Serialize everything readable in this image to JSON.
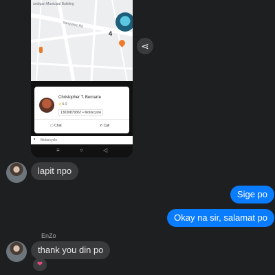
{
  "shared_screenshot": {
    "map": {
      "building_label": "andigan Municipal Building",
      "road_label": "Sampaloc Rd",
      "count": "4"
    },
    "driver": {
      "name": "Christopher T. Bernarte",
      "rating": "5.0",
      "plate_and_vehicle": "13030879367 • Motorcycle"
    },
    "actions": {
      "chat": "Chat",
      "call": "Call"
    },
    "mode": "Motorcycle",
    "nav": {
      "menu": "≡",
      "home": "○",
      "back": "◁"
    }
  },
  "icons": {
    "share": "share-icon",
    "star": "star-icon",
    "heart": "heart-icon"
  },
  "colors": {
    "outgoing_bubble": "#0a7cff",
    "incoming_bubble": "#3a3b3d",
    "background": "#1e1f21"
  },
  "messages": [
    {
      "direction": "incoming",
      "text": "lapit npo"
    },
    {
      "direction": "outgoing",
      "text": "Sige po"
    },
    {
      "direction": "outgoing",
      "text": "Okay na sir, salamat po"
    },
    {
      "direction": "incoming",
      "sender": "EnZo",
      "text": "thank you din po",
      "reaction": "❤"
    }
  ]
}
